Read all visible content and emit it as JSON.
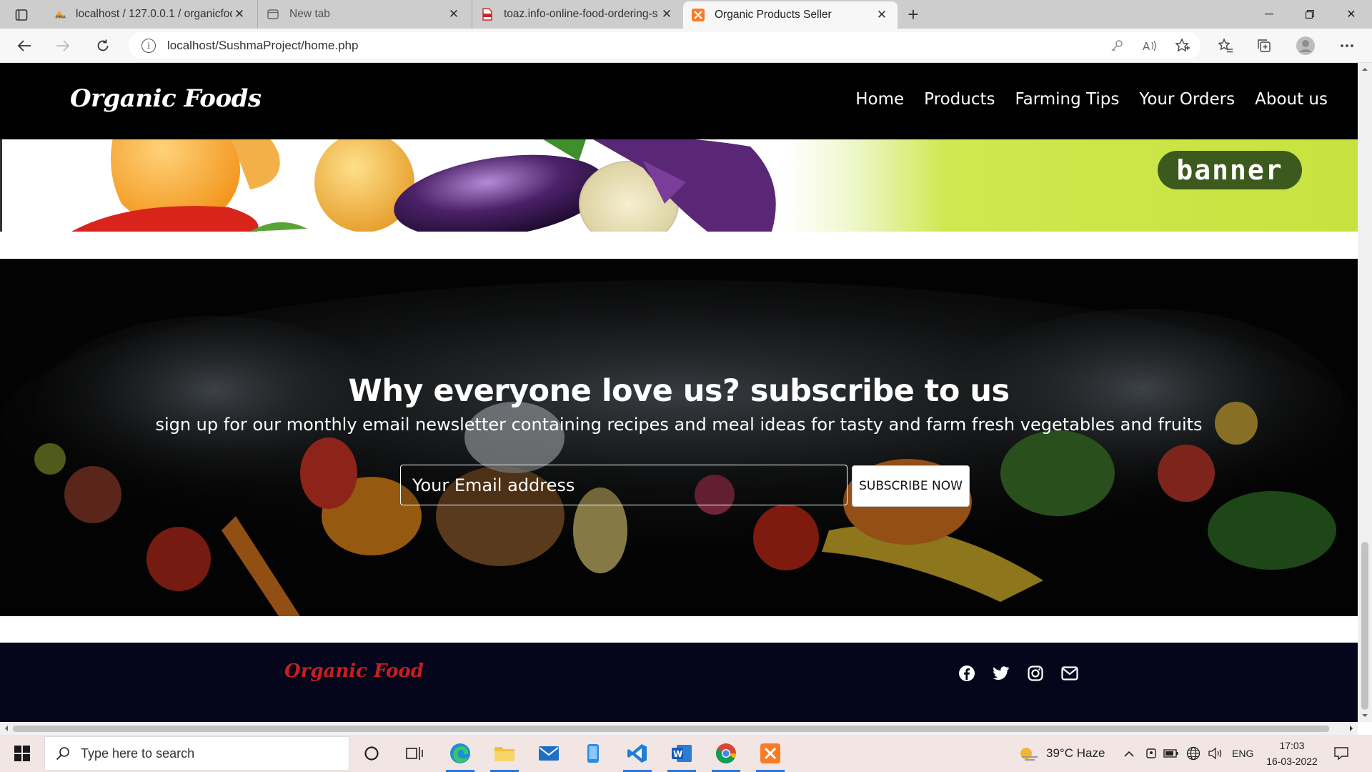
{
  "browser": {
    "tabs": [
      {
        "title": "localhost / 127.0.0.1 / organicfoo",
        "favicon": "phpmyadmin-icon",
        "active": false
      },
      {
        "title": "New tab",
        "favicon": "new-tab-page-icon",
        "active": false
      },
      {
        "title": "toaz.info-online-food-ordering-s",
        "favicon": "pdf-icon",
        "active": false
      },
      {
        "title": "Organic Products Seller",
        "favicon": "xampp-icon",
        "active": true
      }
    ],
    "url": "localhost/SushmaProject/home.php"
  },
  "site": {
    "logo": "Organic Foods",
    "nav": [
      "Home",
      "Products",
      "Farming Tips",
      "Your Orders",
      "About us"
    ],
    "banner_badge": "banner",
    "subscribe": {
      "title": "Why everyone love us? subscribe to us",
      "text": "sign up for our monthly email newsletter containing recipes and meal ideas for tasty and farm fresh vegetables and fruits",
      "placeholder": "Your Email address",
      "button": "SUBSCRIBE NOW"
    },
    "footer": {
      "logo": "Organic Food",
      "social": [
        "facebook-icon",
        "twitter-icon",
        "instagram-icon",
        "envelope-icon"
      ]
    }
  },
  "taskbar": {
    "search_placeholder": "Type here to search",
    "weather": "39°C  Haze",
    "language": "ENG",
    "time": "17:03",
    "date": "16-03-2022"
  },
  "colors": {
    "header_bg": "#000000",
    "footer_bg": "#05051c",
    "footer_logo": "#c81e1e",
    "banner_green": "#c8e23f"
  }
}
